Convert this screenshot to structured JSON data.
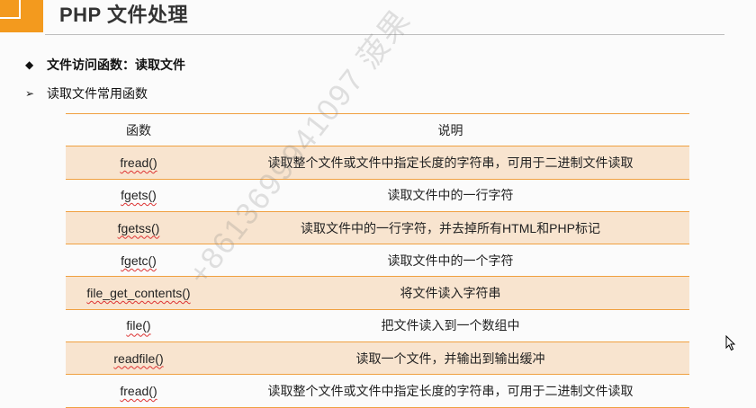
{
  "slide": {
    "title": "PHP 文件处理"
  },
  "bullets": [
    {
      "marker": "◆",
      "text": "文件访问函数：读取文件"
    },
    {
      "marker": "➢",
      "text": "读取文件常用函数"
    }
  ],
  "table": {
    "headers": [
      "函数",
      "说明"
    ],
    "rows": [
      {
        "func": "fread()",
        "desc": "读取整个文件或文件中指定长度的字符串，可用于二进制文件读取"
      },
      {
        "func": "fgets()",
        "desc": "读取文件中的一行字符"
      },
      {
        "func": "fgetss()",
        "desc": "读取文件中的一行字符，并去掉所有HTML和PHP标记"
      },
      {
        "func": "fgetc()",
        "desc": "读取文件中的一个字符"
      },
      {
        "func": "file_get_contents()",
        "desc": "将文件读入字符串"
      },
      {
        "func": "file()",
        "desc": "把文件读入到一个数组中"
      },
      {
        "func": "readfile()",
        "desc": "读取一个文件，并输出到输出缓冲"
      },
      {
        "func": "fread()",
        "desc": "读取整个文件或文件中指定长度的字符串，可用于二进制文件读取"
      }
    ]
  },
  "watermark": "+8613699941097 菠果",
  "colors": {
    "accent": "#f39a1e",
    "row_band": "#f8e4cf",
    "rule": "#f0a040"
  }
}
